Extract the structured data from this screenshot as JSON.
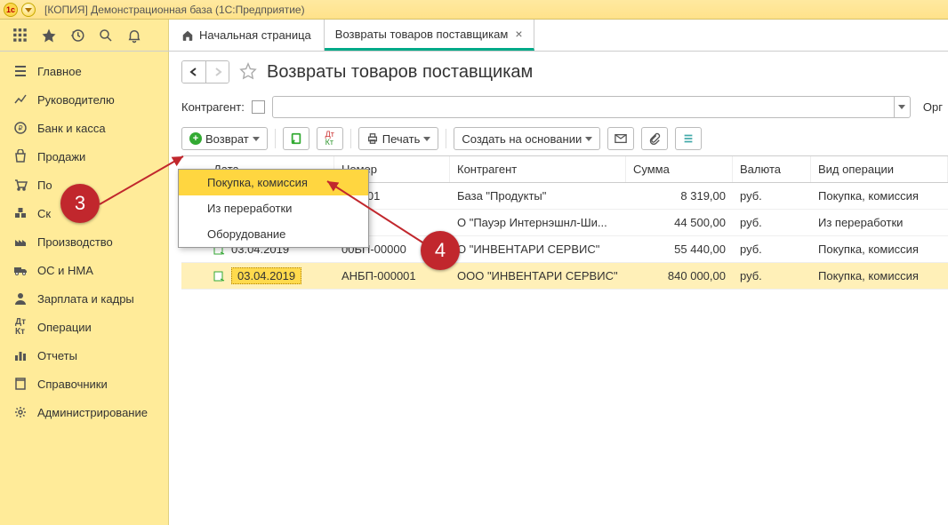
{
  "window": {
    "title": "[КОПИЯ] Демонстрационная база  (1С:Предприятие)"
  },
  "nav": {
    "home_label": "Начальная страница",
    "tab_label": "Возвраты товаров поставщикам"
  },
  "sidebar": {
    "items": [
      {
        "label": "Главное"
      },
      {
        "label": "Руководителю"
      },
      {
        "label": "Банк и касса"
      },
      {
        "label": "Продажи"
      },
      {
        "label": "По"
      },
      {
        "label": "Ск"
      },
      {
        "label": "Производство"
      },
      {
        "label": "ОС и НМА"
      },
      {
        "label": "Зарплата и кадры"
      },
      {
        "label": "Операции"
      },
      {
        "label": "Отчеты"
      },
      {
        "label": "Справочники"
      },
      {
        "label": "Администрирование"
      }
    ]
  },
  "page": {
    "title": "Возвраты товаров поставщикам",
    "filter_label": "Контрагент:",
    "org_label": "Орг"
  },
  "toolbar": {
    "return_label": "Возврат",
    "print_label": "Печать",
    "create_based_label": "Создать на основании"
  },
  "dropdown": {
    "items": [
      {
        "label": "Покупка, комиссия"
      },
      {
        "label": "Из переработки"
      },
      {
        "label": "Оборудование"
      }
    ]
  },
  "table": {
    "columns": {
      "date": "Дата",
      "number": "Номер",
      "contragent": "Контрагент",
      "sum": "Сумма",
      "currency": "Валюта",
      "operation": "Вид операции"
    },
    "rows": [
      {
        "date": "",
        "number": "000001",
        "contragent": "База \"Продукты\"",
        "sum": "8 319,00",
        "currency": "руб.",
        "operation": "Покупка, комиссия"
      },
      {
        "date": "",
        "number": "",
        "contragent": "О \"Пауэр Интернэшнл-Ши...",
        "sum": "44 500,00",
        "currency": "руб.",
        "operation": "Из переработки"
      },
      {
        "date": "03.04.2019",
        "number": "00БП-00000",
        "contragent": "О \"ИНВЕНТАРИ СЕРВИС\"",
        "sum": "55 440,00",
        "currency": "руб.",
        "operation": "Покупка, комиссия"
      },
      {
        "date": "03.04.2019",
        "number": "АНБП-000001",
        "contragent": "ООО \"ИНВЕНТАРИ СЕРВИС\"",
        "sum": "840 000,00",
        "currency": "руб.",
        "operation": "Покупка, комиссия"
      }
    ]
  },
  "badges": {
    "three": "3",
    "four": "4"
  }
}
